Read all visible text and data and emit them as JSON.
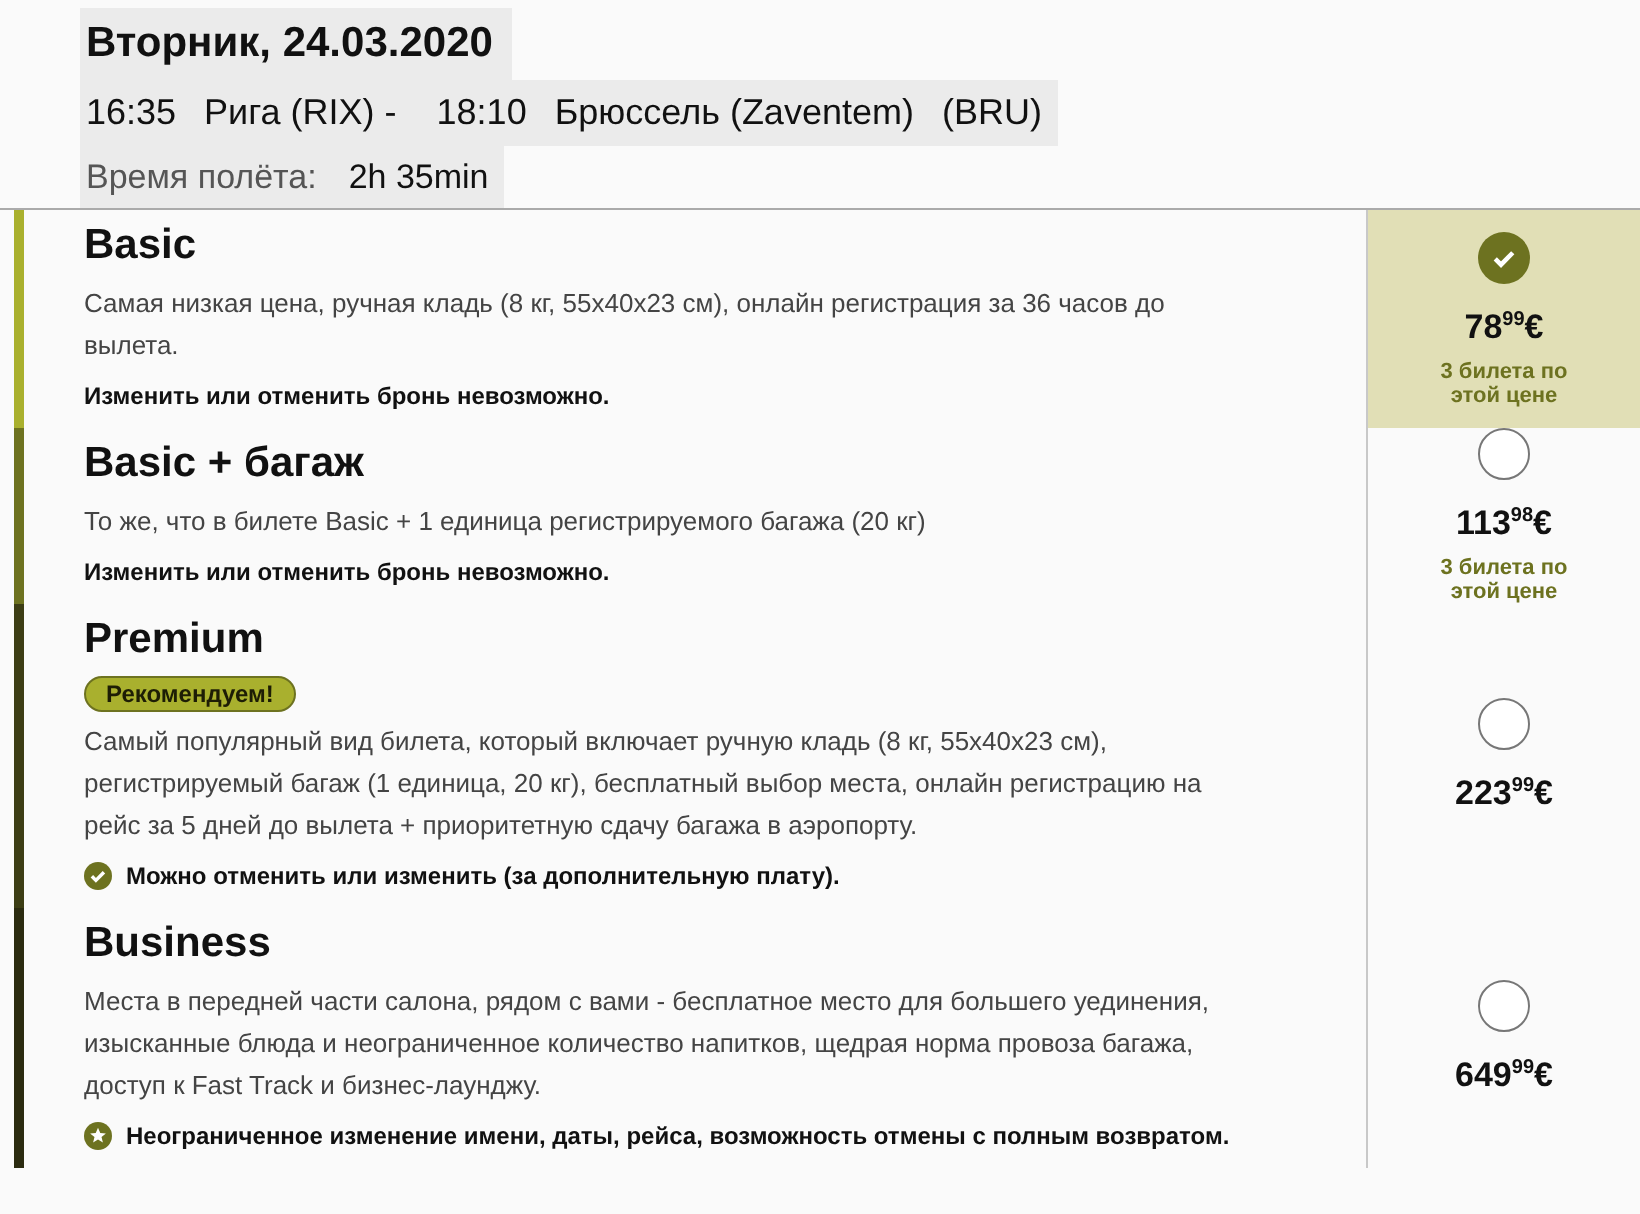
{
  "header": {
    "date": "Вторник, 24.03.2020",
    "route": [
      {
        "text": "16:35"
      },
      {
        "text": "Рига (RIX) -"
      },
      {
        "text": "18:10"
      },
      {
        "text": "Брюссель (Zaventem)"
      },
      {
        "text": "(BRU)"
      }
    ],
    "duration_label": "Время полёта:",
    "duration": "2h 35min"
  },
  "fares": [
    {
      "name": "Basic",
      "color": "#a9b02e",
      "description": "Самая низкая цена, ручная кладь (8 кг, 55x40x23 см), онлайн регистрация за 36 часов до вылета.",
      "note": {
        "text": "Изменить или отменить бронь невозможно.",
        "kind": "plain"
      },
      "price": "78$^{99}$€",
      "seats": "3 билета по этой цене",
      "selected": true
    },
    {
      "name": "Basic + багаж",
      "color": "#6d7220",
      "description": "То же, что в билете Basic + 1 единица регистрируемого багажа (20 кг)",
      "note": {
        "text": "Изменить или отменить бронь невозможно.",
        "kind": "plain"
      },
      "price": "113$^{98}$€",
      "seats": "3 билета по этой цене",
      "selected": false
    },
    {
      "name": "Premium",
      "color": "#3c3d14",
      "badge": "Рекомендуем!",
      "description": "Самый популярный вид билета, который включает ручную кладь (8 кг, 55x40x23 см), регистрируемый багаж (1 единица, 20 кг), бесплатный выбор места, онлайн регистрацию на рейс за 5 дней до вылета + приоритетную сдачу багажа в аэропорту.",
      "note": {
        "text": "Можно отменить или изменить (за дополнительную плату).",
        "kind": "check"
      },
      "price": "223$^{99}$€",
      "selected": false
    },
    {
      "name": "Business",
      "color": "#2b2b10",
      "description": "Места в передней части салона, рядом с вами - бесплатное место для большего уединения, изысканные блюда и неограниченное количество напитков, щедрая норма провоза багажа, доступ к Fast Track и бизнес-лаунджу.",
      "note": {
        "text": "Неограниченное изменение имени, даты, рейса, возможность отмены с полным возвратом.",
        "kind": "star"
      },
      "price": "649$^{99}$€",
      "selected": false
    }
  ]
}
